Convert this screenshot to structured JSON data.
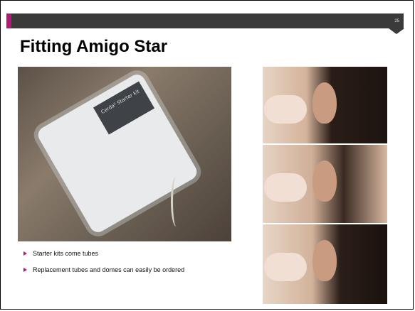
{
  "slide": {
    "page_number": "25",
    "title": "Fitting Amigo Star",
    "accent_color": "#b2187a",
    "header_color": "#3a3a3a"
  },
  "bullets": [
    "Starter kits come tubes",
    "Replacement tubes and domes can easily be ordered"
  ],
  "images": {
    "kit_label": "Cerda² Starter kit"
  }
}
